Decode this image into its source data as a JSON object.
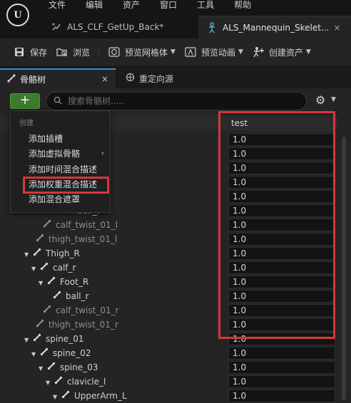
{
  "app": {
    "logo_text": "U",
    "menu": [
      "文件",
      "编辑",
      "资产",
      "窗口",
      "工具",
      "帮助"
    ]
  },
  "doc_tabs": [
    {
      "label": "ALS_CLF_GetUp_Back*",
      "icon": "animation-icon"
    },
    {
      "label": "ALS_Mannequin_Skelet...",
      "icon": "skeleton-icon",
      "close": "×"
    }
  ],
  "toolbar": {
    "save": "保存",
    "browse": "浏览",
    "preview_mesh": "预览网格体",
    "preview_anim": "预览动画",
    "create_asset": "创建资产"
  },
  "panel_tabs": {
    "skeleton_tree": "骨骼树",
    "retarget": "重定向源",
    "close": "×"
  },
  "search": {
    "placeholder": "搜索骨骼树....."
  },
  "add_button": "+",
  "column": {
    "header": "test"
  },
  "context_menu": {
    "title": "创建",
    "items": [
      {
        "label": "添加插槽"
      },
      {
        "label": "添加虚拟骨骼",
        "submenu": "›"
      },
      {
        "label": "添加时间混合描述"
      },
      {
        "label": "添加权重混合描述"
      },
      {
        "label": "添加混合遮罩"
      }
    ]
  },
  "bones": [
    {
      "name": "",
      "value": "1.0"
    },
    {
      "name": "",
      "value": "1.0"
    },
    {
      "name": "",
      "value": "1.0"
    },
    {
      "name": "",
      "value": "1.0"
    },
    {
      "name": "",
      "value": "1.0"
    },
    {
      "name": "ball_l",
      "value": "1.0"
    },
    {
      "name": "calf_twist_01_l",
      "value": "1.0"
    },
    {
      "name": "thigh_twist_01_l",
      "value": "1.0"
    },
    {
      "name": "Thigh_R",
      "value": "1.0"
    },
    {
      "name": "calf_r",
      "value": "1.0"
    },
    {
      "name": "Foot_R",
      "value": "1.0"
    },
    {
      "name": "ball_r",
      "value": "1.0"
    },
    {
      "name": "calf_twist_01_r",
      "value": "1.0"
    },
    {
      "name": "thigh_twist_01_r",
      "value": "1.0"
    },
    {
      "name": "spine_01",
      "value": "1.0"
    },
    {
      "name": "spine_02",
      "value": "1.0"
    },
    {
      "name": "spine_03",
      "value": "1.0"
    },
    {
      "name": "clavicle_l",
      "value": "1.0"
    },
    {
      "name": "UpperArm_L",
      "value": "1.0"
    }
  ]
}
